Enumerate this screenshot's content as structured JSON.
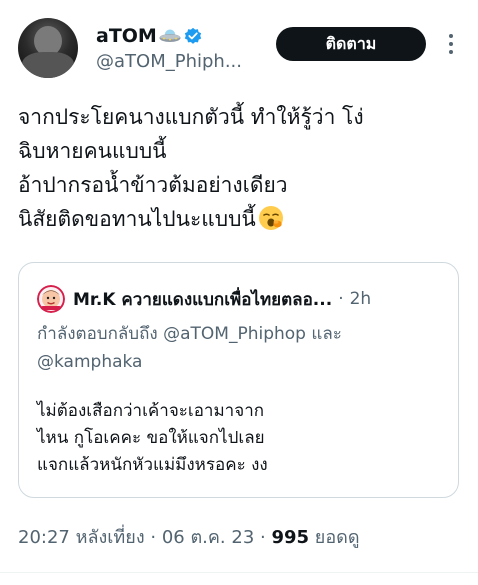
{
  "author": {
    "display_name": "aTOM",
    "handle": "@aTOM_Phiph...",
    "ufo_icon": "flying-saucer-icon",
    "verified_icon": "verified-badge-icon",
    "verified_color": "#1d9bf0"
  },
  "actions": {
    "follow_label": "ติดตาม",
    "more_icon": "more-options-icon"
  },
  "tweet": {
    "lines": [
      "จากประโยคนางแบกตัวนี้ ทำให้รู้ว่า โง่",
      "ฉิบหายคนแบบนี้",
      "อ้าปากรอน้ำข้าวต้มอย่างเดียว",
      "นิสัยติดขอทานไปนะแบบนี้"
    ],
    "emoji": "yawning-face-emoji"
  },
  "quote": {
    "name": "Mr.K ควายแดงแบกเพื่อไทยตลอ...",
    "separator": "·",
    "time": "2h",
    "reply_prefix": "กำลังตอบกลับถึง",
    "reply_user1": "@aTOM_Phiphop",
    "reply_and": "และ",
    "reply_user2": "@kamphaka",
    "lines": [
      "ไม่ต้องเสือกว่าเค้าจะเอามาจาก",
      "ไหน กูโอเคคะ ขอให้แจกไปเลย",
      "แจกแล้วหนักหัวแม่มึงหรอคะ งง"
    ]
  },
  "meta": {
    "time": "20:27 หลังเที่ยง",
    "sep1": "·",
    "date": "06 ต.ค. 23",
    "sep2": "·",
    "views_count": "995",
    "views_label": "ยอดดู"
  }
}
